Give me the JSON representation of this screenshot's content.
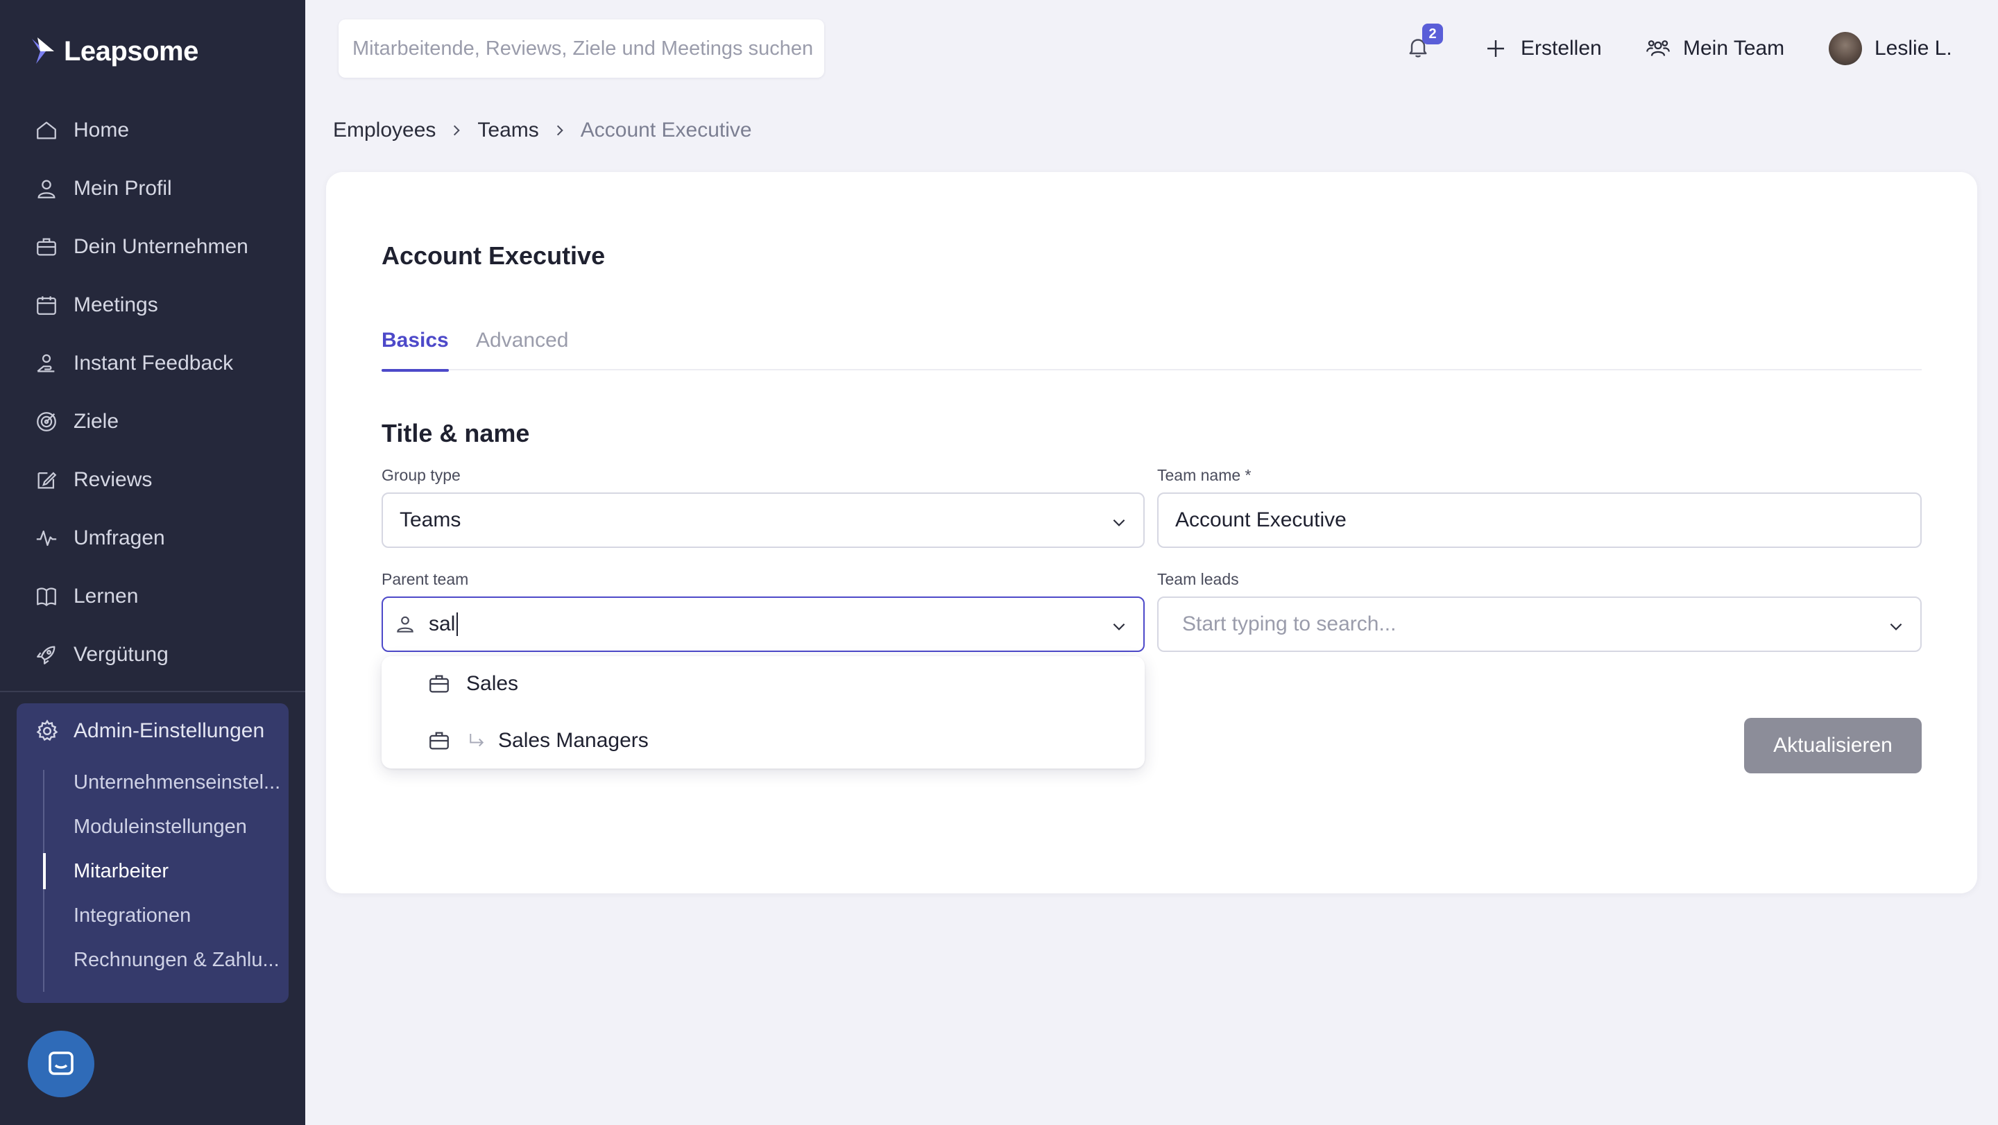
{
  "app": {
    "brand": "Leapsome"
  },
  "sidebar": {
    "items": [
      {
        "label": "Home",
        "icon": "home-icon"
      },
      {
        "label": "Mein Profil",
        "icon": "user-icon"
      },
      {
        "label": "Dein Unternehmen",
        "icon": "briefcase-icon"
      },
      {
        "label": "Meetings",
        "icon": "calendar-icon"
      },
      {
        "label": "Instant Feedback",
        "icon": "feedback-hand-icon"
      },
      {
        "label": "Ziele",
        "icon": "target-icon"
      },
      {
        "label": "Reviews",
        "icon": "edit-icon"
      },
      {
        "label": "Umfragen",
        "icon": "pulse-icon"
      },
      {
        "label": "Lernen",
        "icon": "book-icon"
      },
      {
        "label": "Vergütung",
        "icon": "rocket-icon"
      }
    ],
    "admin": {
      "label": "Admin-Einstellungen",
      "sub_items": [
        {
          "label": "Unternehmenseinstel...",
          "active": false
        },
        {
          "label": "Moduleinstellungen",
          "active": false
        },
        {
          "label": "Mitarbeiter",
          "active": true
        },
        {
          "label": "Integrationen",
          "active": false
        },
        {
          "label": "Rechnungen & Zahlu...",
          "active": false
        }
      ]
    }
  },
  "topbar": {
    "search_placeholder": "Mitarbeitende, Reviews, Ziele und Meetings suchen",
    "notification_count": "2",
    "create_label": "Erstellen",
    "team_label": "Mein Team",
    "user_name": "Leslie L."
  },
  "breadcrumb": {
    "items": [
      "Employees",
      "Teams"
    ],
    "current": "Account Executive"
  },
  "card": {
    "title": "Account Executive",
    "tabs": [
      {
        "label": "Basics",
        "active": true
      },
      {
        "label": "Advanced",
        "active": false
      }
    ],
    "section_title": "Title & name",
    "group_type": {
      "label": "Group type",
      "value": "Teams"
    },
    "team_name": {
      "label": "Team name *",
      "value": "Account Executive"
    },
    "parent_team": {
      "label": "Parent team",
      "value": "sal"
    },
    "team_leads": {
      "label": "Team leads",
      "placeholder": "Start typing to search..."
    },
    "dropdown": [
      {
        "label": "Sales",
        "child": false
      },
      {
        "label": "Sales Managers",
        "child": true
      }
    ],
    "submit_label": "Aktualisieren"
  },
  "colors": {
    "sidebar_bg": "#25283b",
    "admin_bg": "#353a6b",
    "accent": "#4d49c9",
    "page_bg": "#f2f2f8",
    "disabled_button": "#8c8d99"
  }
}
